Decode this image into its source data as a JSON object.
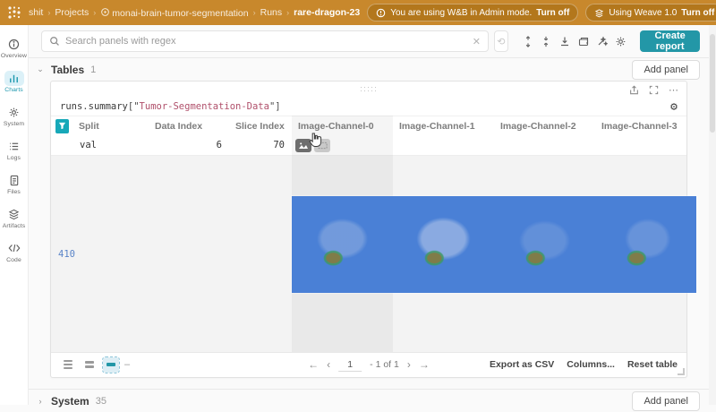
{
  "topbar": {
    "breadcrumb": {
      "entity": "shit",
      "projects": "Projects",
      "project": "monai-brain-tumor-segmentation",
      "runs": "Runs",
      "run": "rare-dragon-23",
      "sep": "›"
    },
    "admin_banner": {
      "text": "You are using W&B in Admin mode.",
      "action": "Turn off"
    },
    "weave_banner": {
      "text": "Using Weave 1.0",
      "action": "Turn off"
    }
  },
  "sidebar": {
    "items": [
      {
        "label": "Overview"
      },
      {
        "label": "Charts"
      },
      {
        "label": "System"
      },
      {
        "label": "Logs"
      },
      {
        "label": "Files"
      },
      {
        "label": "Artifacts"
      },
      {
        "label": "Code"
      }
    ]
  },
  "toolbar": {
    "search_placeholder": "Search panels with regex",
    "create_report_label": "Create report"
  },
  "sections": {
    "tables": {
      "title": "Tables",
      "count": "1",
      "add_panel_label": "Add panel",
      "chevron": "⌄"
    },
    "system": {
      "title": "System",
      "count": "35",
      "add_panel_label": "Add panel",
      "chevron": "›"
    }
  },
  "panel": {
    "query": {
      "obj": "runs",
      "dot": ".",
      "attr": "summary",
      "open": "[\"",
      "key": "Tumor-Segmentation-Data",
      "close": "\"]"
    },
    "table": {
      "columns": {
        "c0": "Split",
        "c1": "Data Index",
        "c2": "Slice Index",
        "c3": "Image-Channel-0",
        "c4": "Image-Channel-1",
        "c5": "Image-Channel-2",
        "c6": "Image-Channel-3"
      },
      "row": {
        "split": "val",
        "data_index": "6",
        "slice_index": "70"
      },
      "expanded_row_index": "410"
    },
    "footer": {
      "page": "1",
      "page_info": "- 1 of 1",
      "first": "←",
      "prev": "‹",
      "next": "›",
      "last": "→",
      "export_label": "Export as CSV",
      "columns_label": "Columns...",
      "reset_label": "Reset table",
      "dash": "–"
    },
    "icons": {
      "more": "⋯",
      "gear": "⚙",
      "clear": "✕",
      "history": "⟲",
      "drag_dots": "·····"
    }
  },
  "colors": {
    "topbar_orange": "#c8882c",
    "accent_teal": "#2397a7",
    "row_index_blue": "#5a84c8",
    "mri_blue": "#4a80d6",
    "tumor_olive": "#7f7c49",
    "tumor_green": "#409860"
  }
}
